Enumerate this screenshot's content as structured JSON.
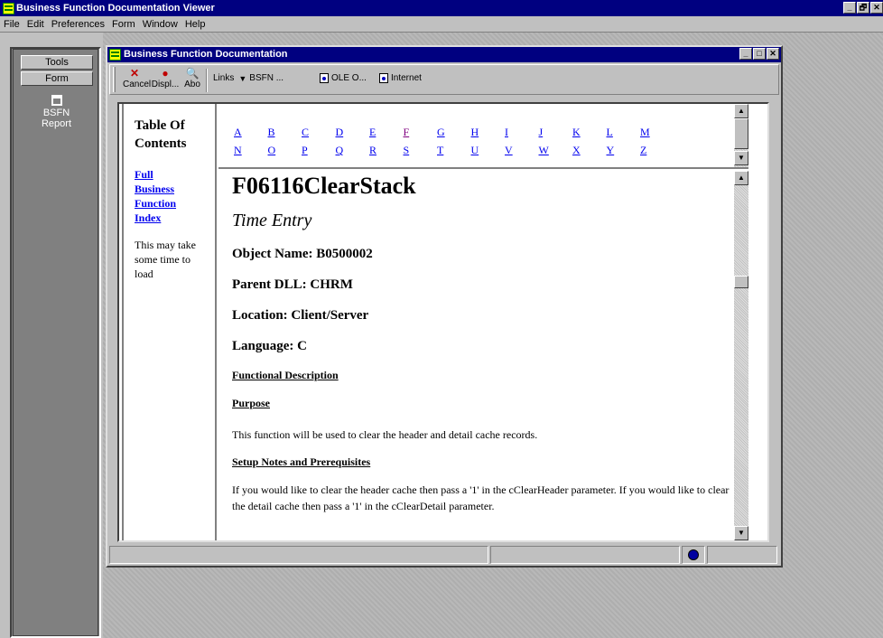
{
  "app": {
    "title": "Business Function Documentation Viewer"
  },
  "window_controls": [
    "_",
    "🗗",
    "✕"
  ],
  "menu": [
    "File",
    "Edit",
    "Preferences",
    "Form",
    "Window",
    "Help"
  ],
  "side_panel": {
    "tools_label": "Tools",
    "form_label": "Form",
    "bsfn_label": "BSFN",
    "report_label": "Report"
  },
  "child": {
    "title": "Business Function Documentation",
    "toolbar": {
      "cancel": "Cancel",
      "display": "Displ...",
      "about": "Abo",
      "links": "Links",
      "bsfn": "BSFN ...",
      "ole": "OLE O...",
      "internet": "Internet"
    }
  },
  "toc": {
    "title": "Table Of Contents",
    "link": "Full Business Function Index",
    "note": "This may take some time to load"
  },
  "alphabet_row1": [
    "A",
    "B",
    "C",
    "D",
    "E",
    "F",
    "G",
    "H",
    "I",
    "J",
    "K",
    "L",
    "M"
  ],
  "alphabet_row2": [
    "N",
    "O",
    "P",
    "Q",
    "R",
    "S",
    "T",
    "U",
    "V",
    "W",
    "X",
    "Y",
    "Z"
  ],
  "doc": {
    "name": "F06116ClearStack",
    "subtitle": "Time Entry",
    "object_name": "Object Name: B0500002",
    "parent_dll": "Parent DLL: CHRM",
    "location": "Location: Client/Server",
    "language": "Language: C",
    "functional_description": "Functional Description",
    "purpose_heading": "Purpose",
    "purpose_text": "This function will be used to clear the header and detail cache records.",
    "setup_heading": "Setup Notes and Prerequisites",
    "setup_text": "If you would like to clear the header cache then pass a '1' in the cClearHeader parameter. If you would like to clear the detail cache then pass a '1' in the cClearDetail parameter."
  },
  "colors": {
    "titlebar": "#000080",
    "link": "#0000ee",
    "visited": "#800080"
  }
}
